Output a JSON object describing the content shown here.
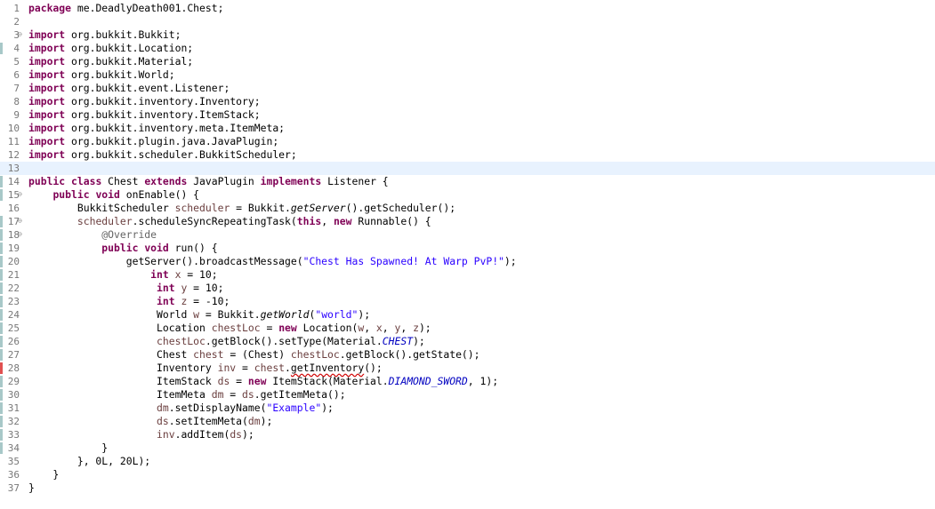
{
  "editor": {
    "lines": [
      {
        "n": "1",
        "tokens": [
          [
            "kw",
            "package"
          ],
          [
            "t",
            " me.DeadlyDeath001.Chest;"
          ]
        ]
      },
      {
        "n": "2",
        "tokens": []
      },
      {
        "n": "3",
        "fold": "⊖",
        "tokens": [
          [
            "kw",
            "import"
          ],
          [
            "t",
            " org.bukkit.Bukkit;"
          ]
        ]
      },
      {
        "n": "4",
        "tokens": [
          [
            "kw",
            "import"
          ],
          [
            "t",
            " org.bukkit.Location;"
          ]
        ]
      },
      {
        "n": "5",
        "tokens": [
          [
            "kw",
            "import"
          ],
          [
            "t",
            " org.bukkit.Material;"
          ]
        ]
      },
      {
        "n": "6",
        "tokens": [
          [
            "kw",
            "import"
          ],
          [
            "t",
            " org.bukkit.World;"
          ]
        ]
      },
      {
        "n": "7",
        "tokens": [
          [
            "kw",
            "import"
          ],
          [
            "t",
            " org.bukkit.event.Listener;"
          ]
        ]
      },
      {
        "n": "8",
        "tokens": [
          [
            "kw",
            "import"
          ],
          [
            "t",
            " org.bukkit.inventory.Inventory;"
          ]
        ]
      },
      {
        "n": "9",
        "tokens": [
          [
            "kw",
            "import"
          ],
          [
            "t",
            " org.bukkit.inventory.ItemStack;"
          ]
        ]
      },
      {
        "n": "10",
        "tokens": [
          [
            "kw",
            "import"
          ],
          [
            "t",
            " org.bukkit.inventory.meta.ItemMeta;"
          ]
        ]
      },
      {
        "n": "11",
        "tokens": [
          [
            "kw",
            "import"
          ],
          [
            "t",
            " org.bukkit.plugin.java.JavaPlugin;"
          ]
        ]
      },
      {
        "n": "12",
        "tokens": [
          [
            "kw",
            "import"
          ],
          [
            "t",
            " org.bukkit.scheduler.BukkitScheduler;"
          ]
        ]
      },
      {
        "n": "13",
        "current": true,
        "tokens": []
      },
      {
        "n": "14",
        "tokens": [
          [
            "kw",
            "public"
          ],
          [
            "t",
            " "
          ],
          [
            "kw",
            "class"
          ],
          [
            "t",
            " Chest "
          ],
          [
            "kw",
            "extends"
          ],
          [
            "t",
            " JavaPlugin "
          ],
          [
            "kw",
            "implements"
          ],
          [
            "t",
            " Listener {"
          ]
        ]
      },
      {
        "n": "15",
        "fold": "⊖",
        "tokens": [
          [
            "t",
            "    "
          ],
          [
            "kw",
            "public"
          ],
          [
            "t",
            " "
          ],
          [
            "kw",
            "void"
          ],
          [
            "t",
            " onEnable() {"
          ]
        ]
      },
      {
        "n": "16",
        "tokens": [
          [
            "t",
            "        BukkitScheduler "
          ],
          [
            "var",
            "scheduler"
          ],
          [
            "t",
            " = Bukkit."
          ],
          [
            "it",
            "getServer"
          ],
          [
            "t",
            "().getScheduler();"
          ]
        ]
      },
      {
        "n": "17",
        "fold": "⊖",
        "tokens": [
          [
            "t",
            "        "
          ],
          [
            "var",
            "scheduler"
          ],
          [
            "t",
            ".scheduleSyncRepeatingTask("
          ],
          [
            "kw",
            "this"
          ],
          [
            "t",
            ", "
          ],
          [
            "kw",
            "new"
          ],
          [
            "t",
            " Runnable() {"
          ]
        ]
      },
      {
        "n": "18",
        "fold": "⊖",
        "tokens": [
          [
            "t",
            "            "
          ],
          [
            "ann",
            "@Override"
          ]
        ]
      },
      {
        "n": "19",
        "tokens": [
          [
            "t",
            "            "
          ],
          [
            "kw",
            "public"
          ],
          [
            "t",
            " "
          ],
          [
            "kw",
            "void"
          ],
          [
            "t",
            " run() {"
          ]
        ]
      },
      {
        "n": "20",
        "tokens": [
          [
            "t",
            "                getServer().broadcastMessage("
          ],
          [
            "str",
            "\"Chest Has Spawned! At Warp PvP!\""
          ],
          [
            "t",
            ");"
          ]
        ]
      },
      {
        "n": "21",
        "tokens": [
          [
            "t",
            "                    "
          ],
          [
            "kw",
            "int"
          ],
          [
            "t",
            " "
          ],
          [
            "var",
            "x"
          ],
          [
            "t",
            " = 10;"
          ]
        ]
      },
      {
        "n": "22",
        "tokens": [
          [
            "t",
            "                     "
          ],
          [
            "kw",
            "int"
          ],
          [
            "t",
            " "
          ],
          [
            "var",
            "y"
          ],
          [
            "t",
            " = 10;"
          ]
        ]
      },
      {
        "n": "23",
        "tokens": [
          [
            "t",
            "                     "
          ],
          [
            "kw",
            "int"
          ],
          [
            "t",
            " "
          ],
          [
            "var",
            "z"
          ],
          [
            "t",
            " = -10;"
          ]
        ]
      },
      {
        "n": "24",
        "tokens": [
          [
            "t",
            "                     World "
          ],
          [
            "var",
            "w"
          ],
          [
            "t",
            " = Bukkit."
          ],
          [
            "it",
            "getWorld"
          ],
          [
            "t",
            "("
          ],
          [
            "str",
            "\"world\""
          ],
          [
            "t",
            ");"
          ]
        ]
      },
      {
        "n": "25",
        "tokens": [
          [
            "t",
            "                     Location "
          ],
          [
            "var",
            "chestLoc"
          ],
          [
            "t",
            " = "
          ],
          [
            "kw",
            "new"
          ],
          [
            "t",
            " Location("
          ],
          [
            "var",
            "w"
          ],
          [
            "t",
            ", "
          ],
          [
            "var",
            "x"
          ],
          [
            "t",
            ", "
          ],
          [
            "var",
            "y"
          ],
          [
            "t",
            ", "
          ],
          [
            "var",
            "z"
          ],
          [
            "t",
            ");"
          ]
        ]
      },
      {
        "n": "26",
        "tokens": [
          [
            "t",
            "                     "
          ],
          [
            "var",
            "chestLoc"
          ],
          [
            "t",
            ".getBlock().setType(Material."
          ],
          [
            "fldit",
            "CHEST"
          ],
          [
            "t",
            ");"
          ]
        ]
      },
      {
        "n": "27",
        "tokens": [
          [
            "t",
            "                     Chest "
          ],
          [
            "var",
            "chest"
          ],
          [
            "t",
            " = (Chest) "
          ],
          [
            "var",
            "chestLoc"
          ],
          [
            "t",
            ".getBlock().getState();"
          ]
        ]
      },
      {
        "n": "28",
        "error": true,
        "tokens": [
          [
            "t",
            "                     Inventory "
          ],
          [
            "var",
            "inv"
          ],
          [
            "t",
            " = "
          ],
          [
            "var",
            "chest"
          ],
          [
            "t",
            "."
          ],
          [
            "err",
            "getInventory"
          ],
          [
            "t",
            "();"
          ]
        ]
      },
      {
        "n": "29",
        "tokens": [
          [
            "t",
            "                     ItemStack "
          ],
          [
            "var",
            "ds"
          ],
          [
            "t",
            " = "
          ],
          [
            "kw",
            "new"
          ],
          [
            "t",
            " ItemStack(Material."
          ],
          [
            "fldit",
            "DIAMOND_SWORD"
          ],
          [
            "t",
            ", 1);"
          ]
        ]
      },
      {
        "n": "30",
        "tokens": [
          [
            "t",
            "                     ItemMeta "
          ],
          [
            "var",
            "dm"
          ],
          [
            "t",
            " = "
          ],
          [
            "var",
            "ds"
          ],
          [
            "t",
            ".getItemMeta();"
          ]
        ]
      },
      {
        "n": "31",
        "tokens": [
          [
            "t",
            "                     "
          ],
          [
            "var",
            "dm"
          ],
          [
            "t",
            ".setDisplayName("
          ],
          [
            "str",
            "\"Example\""
          ],
          [
            "t",
            ");"
          ]
        ]
      },
      {
        "n": "32",
        "tokens": [
          [
            "t",
            "                     "
          ],
          [
            "var",
            "ds"
          ],
          [
            "t",
            ".setItemMeta("
          ],
          [
            "var",
            "dm"
          ],
          [
            "t",
            ");"
          ]
        ]
      },
      {
        "n": "33",
        "tokens": [
          [
            "t",
            "                     "
          ],
          [
            "var",
            "inv"
          ],
          [
            "t",
            ".addItem("
          ],
          [
            "var",
            "ds"
          ],
          [
            "t",
            ");"
          ]
        ]
      },
      {
        "n": "34",
        "tokens": [
          [
            "t",
            "            }"
          ]
        ]
      },
      {
        "n": "35",
        "tokens": [
          [
            "t",
            "        }, 0L, 20L);"
          ]
        ]
      },
      {
        "n": "36",
        "tokens": [
          [
            "t",
            "    }"
          ]
        ]
      },
      {
        "n": "37",
        "tokens": [
          [
            "t",
            "}"
          ]
        ]
      }
    ],
    "colors": {
      "changed_marker": "#a8c8c8",
      "error_marker": "#e05050",
      "current_line": "#e8f2fe"
    }
  }
}
